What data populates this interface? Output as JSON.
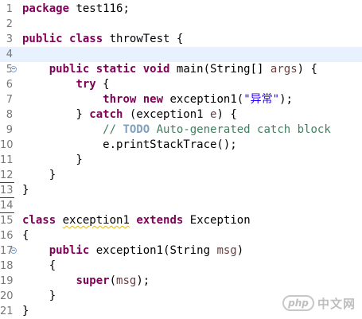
{
  "editor": {
    "lines": [
      {
        "number": "1",
        "segments": [
          {
            "text": "package",
            "type": "kw"
          },
          {
            "text": " test116;",
            "type": "plain"
          }
        ]
      },
      {
        "number": "2",
        "segments": []
      },
      {
        "number": "3",
        "segments": [
          {
            "text": "public",
            "type": "kw"
          },
          {
            "text": " ",
            "type": "plain"
          },
          {
            "text": "class",
            "type": "kw"
          },
          {
            "text": " throwTest {",
            "type": "plain"
          }
        ]
      },
      {
        "number": "4",
        "current": true,
        "segments": []
      },
      {
        "number": "5",
        "fold": true,
        "segments": [
          {
            "text": "    ",
            "type": "plain"
          },
          {
            "text": "public",
            "type": "kw"
          },
          {
            "text": " ",
            "type": "plain"
          },
          {
            "text": "static",
            "type": "kw"
          },
          {
            "text": " ",
            "type": "plain"
          },
          {
            "text": "void",
            "type": "kw"
          },
          {
            "text": " main(String[] ",
            "type": "plain"
          },
          {
            "text": "args",
            "type": "var"
          },
          {
            "text": ") {",
            "type": "plain"
          }
        ]
      },
      {
        "number": "6",
        "segments": [
          {
            "text": "        ",
            "type": "plain"
          },
          {
            "text": "try",
            "type": "kw"
          },
          {
            "text": " {",
            "type": "plain"
          }
        ]
      },
      {
        "number": "7",
        "segments": [
          {
            "text": "            ",
            "type": "plain"
          },
          {
            "text": "throw",
            "type": "kw"
          },
          {
            "text": " ",
            "type": "plain"
          },
          {
            "text": "new",
            "type": "kw"
          },
          {
            "text": " exception1(",
            "type": "plain"
          },
          {
            "text": "\"异常\"",
            "type": "str"
          },
          {
            "text": ");",
            "type": "plain"
          }
        ]
      },
      {
        "number": "8",
        "segments": [
          {
            "text": "        } ",
            "type": "plain"
          },
          {
            "text": "catch",
            "type": "kw"
          },
          {
            "text": " (exception1 ",
            "type": "plain"
          },
          {
            "text": "e",
            "type": "var"
          },
          {
            "text": ") {",
            "type": "plain"
          }
        ]
      },
      {
        "number": "9",
        "segments": [
          {
            "text": "            ",
            "type": "plain"
          },
          {
            "text": "// ",
            "type": "comment"
          },
          {
            "text": "TODO",
            "type": "task"
          },
          {
            "text": " Auto-generated catch block",
            "type": "comment"
          }
        ]
      },
      {
        "number": "10",
        "segments": [
          {
            "text": "            e.printStackTrace();",
            "type": "plain"
          }
        ]
      },
      {
        "number": "11",
        "segments": [
          {
            "text": "        }",
            "type": "plain"
          }
        ]
      },
      {
        "number": "12",
        "rule": true,
        "segments": [
          {
            "text": "    }",
            "type": "plain"
          }
        ]
      },
      {
        "number": "13",
        "rule": true,
        "segments": [
          {
            "text": "}",
            "type": "plain"
          }
        ]
      },
      {
        "number": "14",
        "rule": true,
        "segments": []
      },
      {
        "number": "15",
        "segments": [
          {
            "text": "class",
            "type": "kw"
          },
          {
            "text": " ",
            "type": "plain"
          },
          {
            "text": "exception1",
            "type": "squiggle"
          },
          {
            "text": " ",
            "type": "plain"
          },
          {
            "text": "extends",
            "type": "kw"
          },
          {
            "text": " Exception",
            "type": "plain"
          }
        ]
      },
      {
        "number": "16",
        "segments": [
          {
            "text": "{",
            "type": "plain"
          }
        ]
      },
      {
        "number": "17",
        "fold": true,
        "segments": [
          {
            "text": "    ",
            "type": "plain"
          },
          {
            "text": "public",
            "type": "kw"
          },
          {
            "text": " exception1(String ",
            "type": "plain"
          },
          {
            "text": "msg",
            "type": "var"
          },
          {
            "text": ")",
            "type": "plain"
          }
        ]
      },
      {
        "number": "18",
        "segments": [
          {
            "text": "    {",
            "type": "plain"
          }
        ]
      },
      {
        "number": "19",
        "segments": [
          {
            "text": "        ",
            "type": "plain"
          },
          {
            "text": "super",
            "type": "kw"
          },
          {
            "text": "(",
            "type": "plain"
          },
          {
            "text": "msg",
            "type": "var"
          },
          {
            "text": ");",
            "type": "plain"
          }
        ]
      },
      {
        "number": "20",
        "segments": [
          {
            "text": "    }",
            "type": "plain"
          }
        ]
      },
      {
        "number": "21",
        "segments": [
          {
            "text": "}",
            "type": "plain"
          }
        ]
      }
    ]
  },
  "watermark": {
    "logo": "php",
    "text": "中文网"
  }
}
